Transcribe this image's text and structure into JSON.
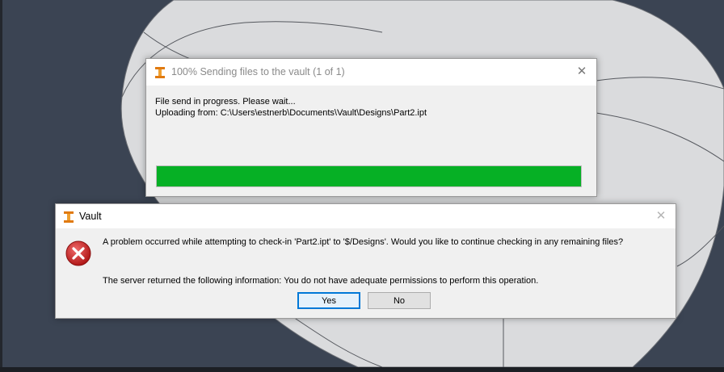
{
  "progress_dialog": {
    "title": "100% Sending files to the vault (1 of 1)",
    "close_glyph": "✕",
    "status_line": "File send in progress. Please wait...",
    "upload_line": "Uploading from: C:\\Users\\estnerb\\Documents\\Vault\\Designs\\Part2.ipt",
    "progress_fraction": 1.0,
    "progress_color": "#06b025",
    "icon": "inventor-app-icon"
  },
  "vault_dialog": {
    "title": "Vault",
    "close_glyph": "✕",
    "icon": "error-icon",
    "message": "A problem occurred while attempting to check-in 'Part2.ipt' to '$/Designs'.  Would you like to continue checking in any remaining files?",
    "server_message": "The server returned the following information:  You do not have adequate permissions to perform this operation.",
    "yes_label": "Yes",
    "no_label": "No"
  },
  "colors": {
    "viewport_background": "#3b4453",
    "model_surface": "#dadbdd",
    "accent_focus": "#0078d7",
    "error_red": "#d13438"
  }
}
